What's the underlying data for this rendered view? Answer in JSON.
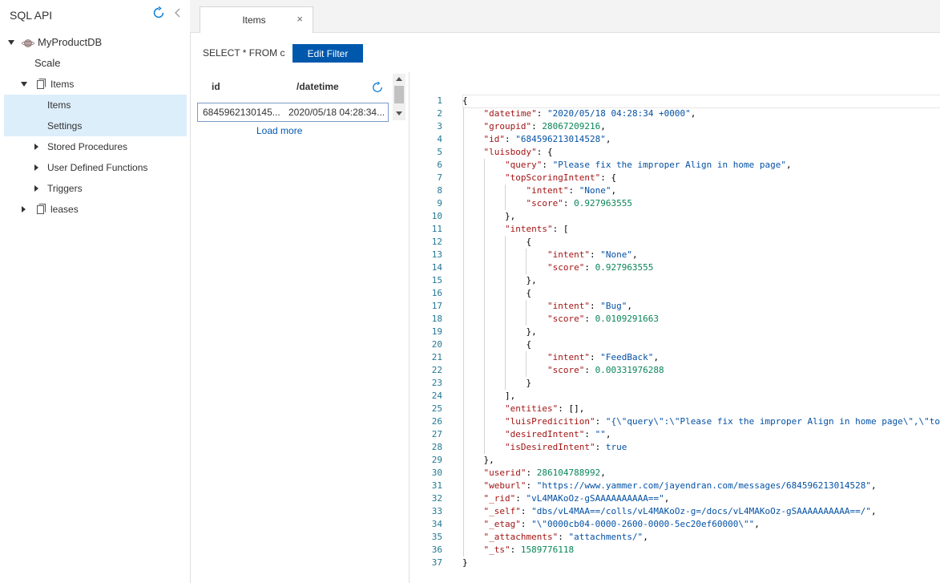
{
  "sidebar": {
    "title": "SQL API",
    "database": "MyProductDB",
    "scale": "Scale",
    "collection": "Items",
    "items_label": "Items",
    "settings_label": "Settings",
    "stored_procedures": "Stored Procedures",
    "udfs": "User Defined Functions",
    "triggers": "Triggers",
    "leases": "leases"
  },
  "tab": {
    "label": "Items",
    "close": "×"
  },
  "query": {
    "text": "SELECT * FROM c",
    "edit_filter": "Edit Filter"
  },
  "grid": {
    "col_id": "id",
    "col_datetime": "/datetime",
    "row_id": "6845962130145...",
    "row_datetime": "2020/05/18 04:28:34...",
    "load_more": "Load more"
  },
  "editor": {
    "lines": [
      "{",
      "    \"datetime\": \"2020/05/18 04:28:34 +0000\",",
      "    \"groupid\": 28067209216,",
      "    \"id\": \"684596213014528\",",
      "    \"luisbody\": {",
      "        \"query\": \"Please fix the improper Align in home page\",",
      "        \"topScoringIntent\": {",
      "            \"intent\": \"None\",",
      "            \"score\": 0.927963555",
      "        },",
      "        \"intents\": [",
      "            {",
      "                \"intent\": \"None\",",
      "                \"score\": 0.927963555",
      "            },",
      "            {",
      "                \"intent\": \"Bug\",",
      "                \"score\": 0.0109291663",
      "            },",
      "            {",
      "                \"intent\": \"FeedBack\",",
      "                \"score\": 0.00331976288",
      "            }",
      "        ],",
      "        \"entities\": [],",
      "        \"luisPredicition\": \"{\\\"query\\\":\\\"Please fix the improper Align in home page\\\",\\\"topS",
      "        \"desiredIntent\": \"\",",
      "        \"isDesiredIntent\": true",
      "    },",
      "    \"userid\": 286104788992,",
      "    \"weburl\": \"https://www.yammer.com/jayendran.com/messages/684596213014528\",",
      "    \"_rid\": \"vL4MAKoOz-gSAAAAAAAAAA==\",",
      "    \"_self\": \"dbs/vL4MAA==/colls/vL4MAKoOz-g=/docs/vL4MAKoOz-gSAAAAAAAAAA==/\",",
      "    \"_etag\": \"\\\"0000cb04-0000-2600-0000-5ec20ef60000\\\"\",",
      "    \"_attachments\": \"attachments/\",",
      "    \"_ts\": 1589776118",
      "}"
    ]
  },
  "colors": {
    "accent": "#0058ad",
    "selection": "#ddeefb",
    "key": "#a31515",
    "string": "#0451a5",
    "number": "#098658",
    "line_number": "#237893"
  }
}
